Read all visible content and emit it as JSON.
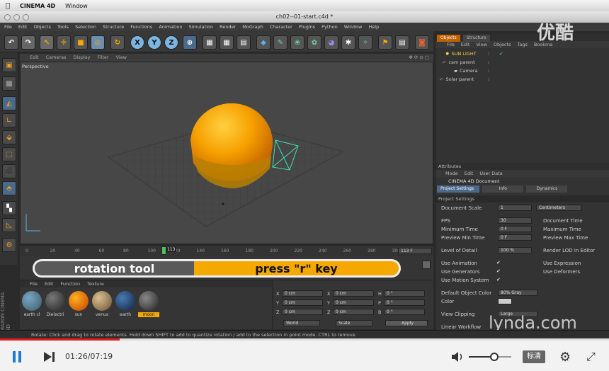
{
  "mac": {
    "app": "CINEMA 4D",
    "menu": "Window"
  },
  "window": {
    "title": "ch02--01-start.c4d *"
  },
  "menubar": [
    "File",
    "Edit",
    "Objects",
    "Tools",
    "Selection",
    "Structure",
    "Functions",
    "Animation",
    "Simulation",
    "Render",
    "MoGraph",
    "Character",
    "Plugins",
    "Python",
    "Window",
    "Help"
  ],
  "viewport": {
    "menu": [
      "Edit",
      "Cameras",
      "Display",
      "Filter",
      "View"
    ],
    "label": "Perspective"
  },
  "timeline": {
    "ticks": [
      "0",
      "20",
      "40",
      "60",
      "80",
      "100",
      "120",
      "140",
      "160",
      "180",
      "200",
      "220",
      "240",
      "260",
      "280",
      "300"
    ],
    "current": "113",
    "end": "113 F"
  },
  "banner": {
    "tool": "rotation tool",
    "hint": "press \"r\" key"
  },
  "materials": {
    "menu": [
      "File",
      "Edit",
      "Function",
      "Texture"
    ],
    "items": [
      "earth cl",
      "Dielectri",
      "sun",
      "venus",
      "earth",
      "moon"
    ]
  },
  "coords": {
    "rows": [
      [
        "X",
        "0 cm",
        "X",
        "0 cm",
        "H",
        "0 °"
      ],
      [
        "Y",
        "0 cm",
        "Y",
        "0 cm",
        "P",
        "0 °"
      ],
      [
        "Z",
        "0 cm",
        "Z",
        "0 cm",
        "B",
        "0 °"
      ]
    ],
    "world": "World",
    "scale": "Scale",
    "apply": "Apply"
  },
  "objects": {
    "tabs": [
      "Objects",
      "Structure"
    ],
    "menu": [
      "File",
      "Edit",
      "View",
      "Objects",
      "Tags",
      "Bookma"
    ],
    "items": [
      "SUN LIGHT",
      "cam parent",
      "Camera",
      "Solar parent"
    ]
  },
  "attributes": {
    "header": "Attributes",
    "menu": [
      "Mode",
      "Edit",
      "User Data"
    ],
    "doc": "CINEMA 4D Document",
    "tabs": [
      "Project Settings",
      "Info",
      "Dynamics"
    ],
    "section": "Project Settings",
    "scale_label": "Document Scale",
    "scale_value": "1",
    "scale_unit": "Centimeters",
    "fps_label": "FPS",
    "fps_value": "30",
    "doctime_label": "Document Time",
    "mintime_label": "Minimum Time",
    "mintime_value": "0 F",
    "maxtime_label": "Maximum Time",
    "prevmin_label": "Preview Min Time",
    "prevmin_value": "0 F",
    "prevmax_label": "Preview Max Time",
    "lod_label": "Level of Detail",
    "lod_value": "100 %",
    "renderlod_label": "Render LOD in Editor",
    "useanim": "Use Animation",
    "useexpr": "Use Expression",
    "usegen": "Use Generators",
    "usedef": "Use Deformers",
    "usemotion": "Use Motion System",
    "defcolor_label": "Default Object Color",
    "defcolor_value": "80% Gray",
    "color_label": "Color",
    "clip_label": "View Clipping",
    "clip_value": "Large",
    "linear_label": "Linear Workflow"
  },
  "status": "Rotate: Click and drag to rotate elements. Hold down SHIFT to add to quantize rotation / add to the selection in point mode, CTRL to remove.",
  "watermarks": {
    "youku": "优酷",
    "lynda": "lynda.com",
    "maxon": "MAXON CINEMA 4D"
  },
  "player": {
    "time": "01:26/07:19",
    "quality": "标清",
    "progress": 0.196,
    "volume": 0.6
  },
  "colors": {
    "accent": "#f5a800",
    "progress": "#e02020",
    "sphere": "#f6a000"
  }
}
